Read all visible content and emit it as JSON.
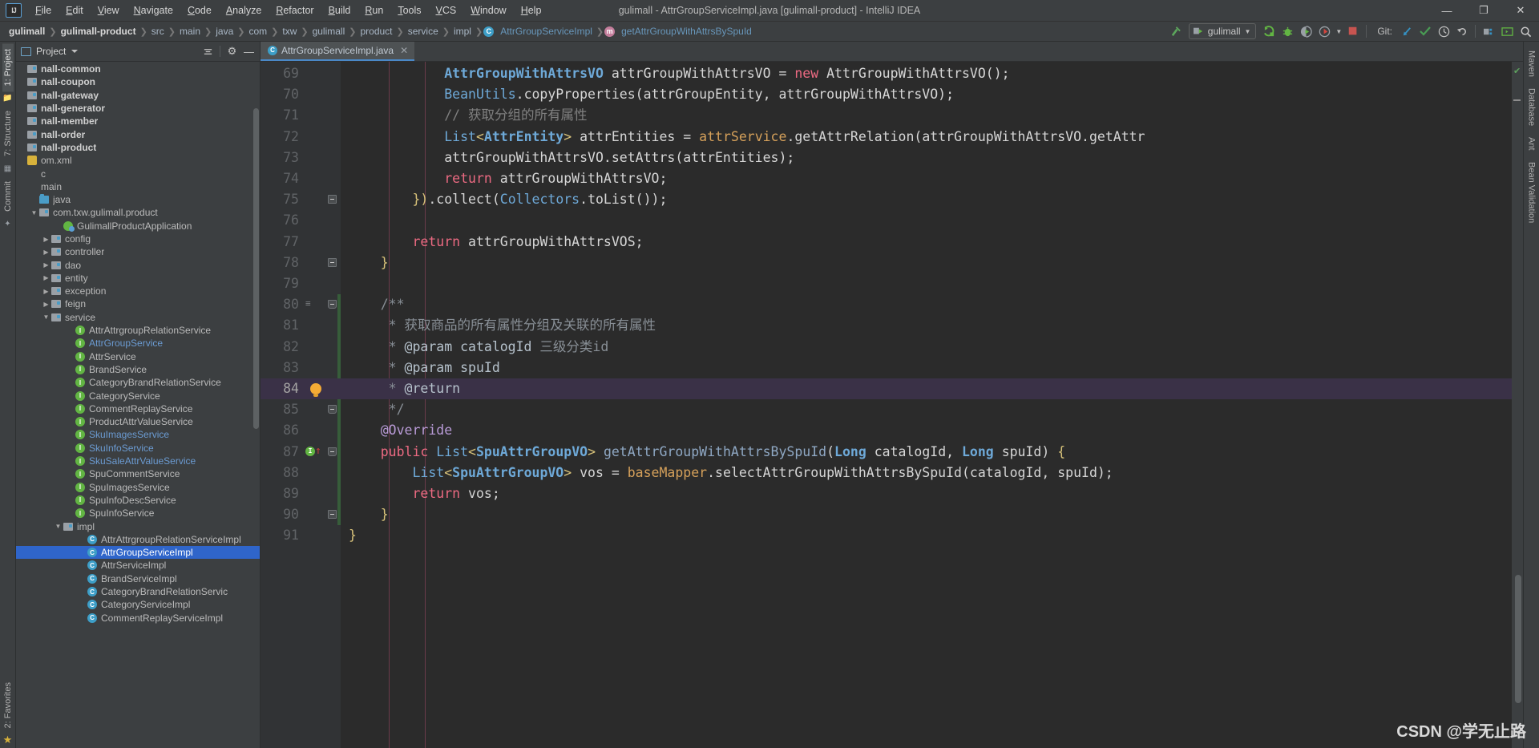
{
  "window": {
    "title": "gulimall - AttrGroupServiceImpl.java [gulimall-product] - IntelliJ IDEA",
    "minimize": "—",
    "maximize": "❐",
    "close": "✕",
    "logo": "IJ"
  },
  "menu": {
    "items": [
      "File",
      "Edit",
      "View",
      "Navigate",
      "Code",
      "Analyze",
      "Refactor",
      "Build",
      "Run",
      "Tools",
      "VCS",
      "Window",
      "Help"
    ]
  },
  "breadcrumb": {
    "items": [
      {
        "label": "gulimall",
        "style": "bold"
      },
      {
        "label": "gulimall-product",
        "style": "bold"
      },
      {
        "label": "src",
        "style": "plain"
      },
      {
        "label": "main",
        "style": "plain"
      },
      {
        "label": "java",
        "style": "plain"
      },
      {
        "label": "com",
        "style": "plain"
      },
      {
        "label": "txw",
        "style": "plain"
      },
      {
        "label": "gulimall",
        "style": "plain"
      },
      {
        "label": "product",
        "style": "plain"
      },
      {
        "label": "service",
        "style": "plain"
      },
      {
        "label": "impl",
        "style": "plain"
      },
      {
        "label": "AttrGroupServiceImpl",
        "style": "link",
        "icon": "class-icon",
        "icon_letter": "C"
      },
      {
        "label": "getAttrGroupWithAttrsBySpuId",
        "style": "link",
        "icon": "method-icon",
        "icon_letter": "m"
      }
    ],
    "separator": "❯"
  },
  "toolbar": {
    "build_icon": "hammer-icon",
    "run_config": {
      "label": "gulimall",
      "icon": "run-config-icon",
      "caret": "▼"
    },
    "run_icon": "run-icon",
    "debug_icon": "debug-icon",
    "coverage_icon": "coverage-icon",
    "profile_icon": "profile-icon",
    "stop_icon": "stop-icon",
    "git_label": "Git:",
    "git_update_icon": "update-project-icon",
    "git_commit_icon": "commit-icon",
    "git_history_icon": "history-icon",
    "git_rollback_icon": "rollback-icon",
    "structure_icon": "module-settings-icon",
    "terminal_icon": "terminal-icon",
    "search_icon": "search-everywhere-icon"
  },
  "left_rail": {
    "tabs": [
      "1: Project",
      "7: Structure",
      "Commit"
    ],
    "bottom": [
      "2: Favorites"
    ],
    "star_icon": "star-icon"
  },
  "right_rail": {
    "tabs": [
      "Maven",
      "Database",
      "Ant",
      "Bean Validation"
    ]
  },
  "project_panel": {
    "title": "Project",
    "caret": "▼",
    "collapse_icon": "collapse-all-icon",
    "settings_icon": "gear-icon",
    "hide_icon": "hide-icon",
    "tree": [
      {
        "label": "nall-common",
        "indent": 0,
        "arrow": "none",
        "icon": "module-icon",
        "style": "bold"
      },
      {
        "label": "nall-coupon",
        "indent": 0,
        "arrow": "none",
        "icon": "module-icon",
        "style": "bold"
      },
      {
        "label": "nall-gateway",
        "indent": 0,
        "arrow": "none",
        "icon": "module-icon",
        "style": "bold"
      },
      {
        "label": "nall-generator",
        "indent": 0,
        "arrow": "none",
        "icon": "module-icon",
        "style": "bold"
      },
      {
        "label": "nall-member",
        "indent": 0,
        "arrow": "none",
        "icon": "module-icon",
        "style": "bold"
      },
      {
        "label": "nall-order",
        "indent": 0,
        "arrow": "none",
        "icon": "module-icon",
        "style": "bold"
      },
      {
        "label": "nall-product",
        "indent": 0,
        "arrow": "none",
        "icon": "module-icon",
        "style": "bold"
      },
      {
        "label": "om.xml",
        "indent": 0,
        "arrow": "none",
        "icon": "xml-icon",
        "style": "plain"
      },
      {
        "label": "c",
        "indent": 0,
        "arrow": "none",
        "icon": "none",
        "style": "plain"
      },
      {
        "label": "main",
        "indent": 0,
        "arrow": "none",
        "icon": "none",
        "style": "plain"
      },
      {
        "label": "java",
        "indent": 1,
        "arrow": "none",
        "icon": "source-folder-icon",
        "style": "plain"
      },
      {
        "label": "com.txw.gulimall.product",
        "indent": 1,
        "arrow": "open",
        "icon": "package-icon",
        "style": "plain"
      },
      {
        "label": "GulimallProductApplication",
        "indent": 3,
        "arrow": "none",
        "icon": "spring-class-icon",
        "style": "plain"
      },
      {
        "label": "config",
        "indent": 2,
        "arrow": "closed",
        "icon": "package-icon",
        "style": "plain"
      },
      {
        "label": "controller",
        "indent": 2,
        "arrow": "closed",
        "icon": "package-icon",
        "style": "plain"
      },
      {
        "label": "dao",
        "indent": 2,
        "arrow": "closed",
        "icon": "package-icon",
        "style": "plain"
      },
      {
        "label": "entity",
        "indent": 2,
        "arrow": "closed",
        "icon": "package-icon",
        "style": "plain"
      },
      {
        "label": "exception",
        "indent": 2,
        "arrow": "closed",
        "icon": "package-icon",
        "style": "plain"
      },
      {
        "label": "feign",
        "indent": 2,
        "arrow": "closed",
        "icon": "package-icon",
        "style": "plain"
      },
      {
        "label": "service",
        "indent": 2,
        "arrow": "open",
        "icon": "package-icon",
        "style": "plain"
      },
      {
        "label": "AttrAttrgroupRelationService",
        "indent": 4,
        "arrow": "none",
        "icon": "interface-icon",
        "style": "plain"
      },
      {
        "label": "AttrGroupService",
        "indent": 4,
        "arrow": "none",
        "icon": "interface-icon",
        "style": "blue"
      },
      {
        "label": "AttrService",
        "indent": 4,
        "arrow": "none",
        "icon": "interface-icon",
        "style": "plain"
      },
      {
        "label": "BrandService",
        "indent": 4,
        "arrow": "none",
        "icon": "interface-icon",
        "style": "plain"
      },
      {
        "label": "CategoryBrandRelationService",
        "indent": 4,
        "arrow": "none",
        "icon": "interface-icon",
        "style": "plain"
      },
      {
        "label": "CategoryService",
        "indent": 4,
        "arrow": "none",
        "icon": "interface-icon",
        "style": "plain"
      },
      {
        "label": "CommentReplayService",
        "indent": 4,
        "arrow": "none",
        "icon": "interface-icon",
        "style": "plain"
      },
      {
        "label": "ProductAttrValueService",
        "indent": 4,
        "arrow": "none",
        "icon": "interface-icon",
        "style": "plain"
      },
      {
        "label": "SkuImagesService",
        "indent": 4,
        "arrow": "none",
        "icon": "interface-icon",
        "style": "blue"
      },
      {
        "label": "SkuInfoService",
        "indent": 4,
        "arrow": "none",
        "icon": "interface-icon",
        "style": "blue"
      },
      {
        "label": "SkuSaleAttrValueService",
        "indent": 4,
        "arrow": "none",
        "icon": "interface-icon",
        "style": "blue"
      },
      {
        "label": "SpuCommentService",
        "indent": 4,
        "arrow": "none",
        "icon": "interface-icon",
        "style": "plain"
      },
      {
        "label": "SpuImagesService",
        "indent": 4,
        "arrow": "none",
        "icon": "interface-icon",
        "style": "plain"
      },
      {
        "label": "SpuInfoDescService",
        "indent": 4,
        "arrow": "none",
        "icon": "interface-icon",
        "style": "plain"
      },
      {
        "label": "SpuInfoService",
        "indent": 4,
        "arrow": "none",
        "icon": "interface-icon",
        "style": "plain"
      },
      {
        "label": "impl",
        "indent": 3,
        "arrow": "open",
        "icon": "package-icon",
        "style": "plain"
      },
      {
        "label": "AttrAttrgroupRelationServiceImpl",
        "indent": 5,
        "arrow": "none",
        "icon": "class-icon",
        "style": "plain"
      },
      {
        "label": "AttrGroupServiceImpl",
        "indent": 5,
        "arrow": "none",
        "icon": "class-icon",
        "style": "selected"
      },
      {
        "label": "AttrServiceImpl",
        "indent": 5,
        "arrow": "none",
        "icon": "class-icon",
        "style": "plain"
      },
      {
        "label": "BrandServiceImpl",
        "indent": 5,
        "arrow": "none",
        "icon": "class-icon",
        "style": "plain"
      },
      {
        "label": "CategoryBrandRelationServic",
        "indent": 5,
        "arrow": "none",
        "icon": "class-icon",
        "style": "plain"
      },
      {
        "label": "CategoryServiceImpl",
        "indent": 5,
        "arrow": "none",
        "icon": "class-icon",
        "style": "plain"
      },
      {
        "label": "CommentReplayServiceImpl",
        "indent": 5,
        "arrow": "none",
        "icon": "class-icon",
        "style": "plain"
      }
    ]
  },
  "editor": {
    "tab": {
      "label": "AttrGroupServiceImpl.java",
      "icon": "class-icon",
      "icon_letter": "C",
      "close": "✕"
    },
    "current_line": 84,
    "first_line": 69,
    "lines": [
      {
        "n": 69,
        "html": "            <span class=\"t-clsb\">AttrGroupWithAttrsVO</span> <span class=\"t-ident\">attrGroupWithAttrsVO</span> <span class=\"t-op\">=</span> <span class=\"t-kwr\">new</span> <span class=\"t-ident\">AttrGroupWithAttrsVO</span><span class=\"t-punct\">();</span>"
      },
      {
        "n": 70,
        "html": "            <span class=\"t-cls\">BeanUtils</span><span class=\"t-punct\">.</span><span class=\"t-ident\">copyProperties</span><span class=\"t-punct\">(</span><span class=\"t-ident\">attrGroupEntity</span><span class=\"t-punct\">,</span> <span class=\"t-ident\">attrGroupWithAttrsVO</span><span class=\"t-punct\">);</span>"
      },
      {
        "n": 71,
        "html": "            <span class=\"t-cmt\">// 获取分组的所有属性</span>"
      },
      {
        "n": 72,
        "html": "            <span class=\"t-cls\">List</span><span class=\"t-yellow\">&lt;</span><span class=\"t-clsb\">AttrEntity</span><span class=\"t-yellow\">&gt;</span> <span class=\"t-ident\">attrEntities</span> <span class=\"t-op\">=</span> <span class=\"t-field\">attrService</span><span class=\"t-punct\">.</span><span class=\"t-ident\">getAttrRelation</span><span class=\"t-punct\">(</span><span class=\"t-ident\">attrGroupWithAttrsVO</span><span class=\"t-punct\">.</span><span class=\"t-ident\">getAttr</span>"
      },
      {
        "n": 73,
        "html": "            <span class=\"t-ident\">attrGroupWithAttrsVO</span><span class=\"t-punct\">.</span><span class=\"t-ident\">setAttrs</span><span class=\"t-punct\">(</span><span class=\"t-ident\">attrEntities</span><span class=\"t-punct\">);</span>"
      },
      {
        "n": 74,
        "html": "            <span class=\"t-kwr\">return</span> <span class=\"t-ident\">attrGroupWithAttrsVO</span><span class=\"t-punct\">;</span>"
      },
      {
        "n": 75,
        "html": "        <span class=\"t-yellow\">})</span><span class=\"t-punct\">.</span><span class=\"t-ident\">collect</span><span class=\"t-punct\">(</span><span class=\"t-cls\">Collectors</span><span class=\"t-punct\">.</span><span class=\"t-ident\">toList</span><span class=\"t-punct\">());</span>"
      },
      {
        "n": 76,
        "html": ""
      },
      {
        "n": 77,
        "html": "        <span class=\"t-kwr\">return</span> <span class=\"t-ident\">attrGroupWithAttrsVOS</span><span class=\"t-punct\">;</span>"
      },
      {
        "n": 78,
        "html": "    <span class=\"t-yellow\">}</span>"
      },
      {
        "n": 79,
        "html": ""
      },
      {
        "n": 80,
        "html": "    <span class=\"t-doc\">/**</span>"
      },
      {
        "n": 81,
        "html": "     <span class=\"t-doc\">* 获取商品的所有属性分组及关联的所有属性</span>"
      },
      {
        "n": 82,
        "html": "     <span class=\"t-doc\">* </span><span class=\"t-doctag\">@param catalogId</span><span class=\"t-doc\"> 三级分类id</span>"
      },
      {
        "n": 83,
        "html": "     <span class=\"t-doc\">* </span><span class=\"t-doctag\">@param spuId</span>"
      },
      {
        "n": 84,
        "html": "     <span class=\"t-doc\">* </span><span class=\"t-doctag\">@return</span>"
      },
      {
        "n": 85,
        "html": "     <span class=\"t-doc\">*/</span>"
      },
      {
        "n": 86,
        "html": "    <span class=\"t-anno\">@Override</span>"
      },
      {
        "n": 87,
        "html": "    <span class=\"t-kwr\">public</span> <span class=\"t-cls\">List</span><span class=\"t-yellow\">&lt;</span><span class=\"t-clsb\">SpuAttrGroupVO</span><span class=\"t-yellow\">&gt;</span> <span class=\"t-meth\">getAttrGroupWithAttrsBySpuId</span><span class=\"t-punct\">(</span><span class=\"t-clsb\">Long</span> <span class=\"t-ident\">catalogId</span><span class=\"t-punct\">,</span> <span class=\"t-clsb\">Long</span> <span class=\"t-ident\">spuId</span><span class=\"t-punct\">)</span> <span class=\"t-yellow\">{</span>"
      },
      {
        "n": 88,
        "html": "        <span class=\"t-cls\">List</span><span class=\"t-yellow\">&lt;</span><span class=\"t-clsb\">SpuAttrGroupVO</span><span class=\"t-yellow\">&gt;</span> <span class=\"t-ident\">vos</span> <span class=\"t-op\">=</span> <span class=\"t-field\">baseMapper</span><span class=\"t-punct\">.</span><span class=\"t-ident\">selectAttrGroupWithAttrsBySpuId</span><span class=\"t-punct\">(</span><span class=\"t-ident\">catalogId</span><span class=\"t-punct\">,</span> <span class=\"t-ident\">spuId</span><span class=\"t-punct\">);</span>"
      },
      {
        "n": 89,
        "html": "        <span class=\"t-kwr\">return</span> <span class=\"t-ident\">vos</span><span class=\"t-punct\">;</span>"
      },
      {
        "n": 90,
        "html": "    <span class=\"t-yellow\">}</span>"
      },
      {
        "n": 91,
        "html": "<span class=\"t-yellow\">}</span>"
      }
    ],
    "gutter": {
      "bulb_icon": "intention-bulb-icon",
      "override_icon": "overriding-method-icon",
      "override_letter": "I"
    },
    "inspection": {
      "status_icon": "inspection-ok-icon",
      "status": "✔"
    }
  },
  "watermark": {
    "text": "CSDN @学无止路"
  },
  "colors": {
    "accent": "#4a88c7",
    "selection": "#2f65ca",
    "editor_bg": "#2b2b2b",
    "panel_bg": "#3c3f41",
    "gutter_bg": "#313335",
    "keyword": "#ec6a82",
    "class": "#6ea9d8",
    "comment": "#808080",
    "field": "#d5a05a",
    "annotation": "#b99bd7",
    "vcs_green": "#375d3a",
    "interface_green": "#62b543"
  }
}
